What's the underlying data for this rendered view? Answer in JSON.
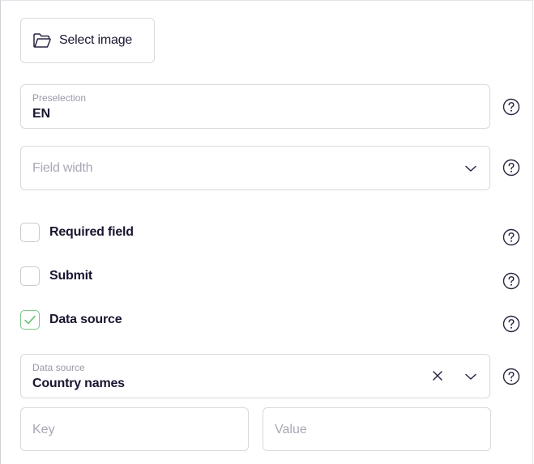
{
  "select_image": {
    "label": "Select image",
    "icon": "folder-open-icon"
  },
  "preselection": {
    "label": "Preselection",
    "value": "EN"
  },
  "field_width": {
    "placeholder": "Field width"
  },
  "checkboxes": [
    {
      "label": "Required field",
      "checked": false
    },
    {
      "label": "Submit",
      "checked": false
    },
    {
      "label": "Data source",
      "checked": true
    }
  ],
  "data_source": {
    "label": "Data source",
    "value": "Country names"
  },
  "key_field": {
    "placeholder": "Key"
  },
  "value_field": {
    "placeholder": "Value"
  },
  "colors": {
    "text": "#1a1530",
    "border": "#d9d9e0",
    "muted": "#9a98a8",
    "check_accent": "#5cbf6e"
  }
}
